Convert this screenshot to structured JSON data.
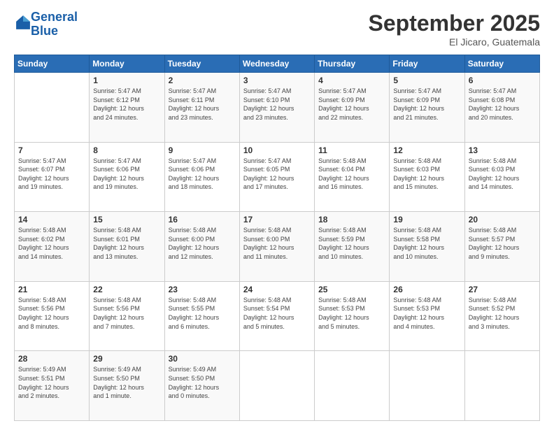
{
  "header": {
    "logo_line1": "General",
    "logo_line2": "Blue",
    "month": "September 2025",
    "location": "El Jicaro, Guatemala"
  },
  "columns": [
    "Sunday",
    "Monday",
    "Tuesday",
    "Wednesday",
    "Thursday",
    "Friday",
    "Saturday"
  ],
  "weeks": [
    [
      {
        "day": "",
        "text": ""
      },
      {
        "day": "1",
        "text": "Sunrise: 5:47 AM\nSunset: 6:12 PM\nDaylight: 12 hours\nand 24 minutes."
      },
      {
        "day": "2",
        "text": "Sunrise: 5:47 AM\nSunset: 6:11 PM\nDaylight: 12 hours\nand 23 minutes."
      },
      {
        "day": "3",
        "text": "Sunrise: 5:47 AM\nSunset: 6:10 PM\nDaylight: 12 hours\nand 23 minutes."
      },
      {
        "day": "4",
        "text": "Sunrise: 5:47 AM\nSunset: 6:09 PM\nDaylight: 12 hours\nand 22 minutes."
      },
      {
        "day": "5",
        "text": "Sunrise: 5:47 AM\nSunset: 6:09 PM\nDaylight: 12 hours\nand 21 minutes."
      },
      {
        "day": "6",
        "text": "Sunrise: 5:47 AM\nSunset: 6:08 PM\nDaylight: 12 hours\nand 20 minutes."
      }
    ],
    [
      {
        "day": "7",
        "text": "Sunrise: 5:47 AM\nSunset: 6:07 PM\nDaylight: 12 hours\nand 19 minutes."
      },
      {
        "day": "8",
        "text": "Sunrise: 5:47 AM\nSunset: 6:06 PM\nDaylight: 12 hours\nand 19 minutes."
      },
      {
        "day": "9",
        "text": "Sunrise: 5:47 AM\nSunset: 6:06 PM\nDaylight: 12 hours\nand 18 minutes."
      },
      {
        "day": "10",
        "text": "Sunrise: 5:47 AM\nSunset: 6:05 PM\nDaylight: 12 hours\nand 17 minutes."
      },
      {
        "day": "11",
        "text": "Sunrise: 5:48 AM\nSunset: 6:04 PM\nDaylight: 12 hours\nand 16 minutes."
      },
      {
        "day": "12",
        "text": "Sunrise: 5:48 AM\nSunset: 6:03 PM\nDaylight: 12 hours\nand 15 minutes."
      },
      {
        "day": "13",
        "text": "Sunrise: 5:48 AM\nSunset: 6:03 PM\nDaylight: 12 hours\nand 14 minutes."
      }
    ],
    [
      {
        "day": "14",
        "text": "Sunrise: 5:48 AM\nSunset: 6:02 PM\nDaylight: 12 hours\nand 14 minutes."
      },
      {
        "day": "15",
        "text": "Sunrise: 5:48 AM\nSunset: 6:01 PM\nDaylight: 12 hours\nand 13 minutes."
      },
      {
        "day": "16",
        "text": "Sunrise: 5:48 AM\nSunset: 6:00 PM\nDaylight: 12 hours\nand 12 minutes."
      },
      {
        "day": "17",
        "text": "Sunrise: 5:48 AM\nSunset: 6:00 PM\nDaylight: 12 hours\nand 11 minutes."
      },
      {
        "day": "18",
        "text": "Sunrise: 5:48 AM\nSunset: 5:59 PM\nDaylight: 12 hours\nand 10 minutes."
      },
      {
        "day": "19",
        "text": "Sunrise: 5:48 AM\nSunset: 5:58 PM\nDaylight: 12 hours\nand 10 minutes."
      },
      {
        "day": "20",
        "text": "Sunrise: 5:48 AM\nSunset: 5:57 PM\nDaylight: 12 hours\nand 9 minutes."
      }
    ],
    [
      {
        "day": "21",
        "text": "Sunrise: 5:48 AM\nSunset: 5:56 PM\nDaylight: 12 hours\nand 8 minutes."
      },
      {
        "day": "22",
        "text": "Sunrise: 5:48 AM\nSunset: 5:56 PM\nDaylight: 12 hours\nand 7 minutes."
      },
      {
        "day": "23",
        "text": "Sunrise: 5:48 AM\nSunset: 5:55 PM\nDaylight: 12 hours\nand 6 minutes."
      },
      {
        "day": "24",
        "text": "Sunrise: 5:48 AM\nSunset: 5:54 PM\nDaylight: 12 hours\nand 5 minutes."
      },
      {
        "day": "25",
        "text": "Sunrise: 5:48 AM\nSunset: 5:53 PM\nDaylight: 12 hours\nand 5 minutes."
      },
      {
        "day": "26",
        "text": "Sunrise: 5:48 AM\nSunset: 5:53 PM\nDaylight: 12 hours\nand 4 minutes."
      },
      {
        "day": "27",
        "text": "Sunrise: 5:48 AM\nSunset: 5:52 PM\nDaylight: 12 hours\nand 3 minutes."
      }
    ],
    [
      {
        "day": "28",
        "text": "Sunrise: 5:49 AM\nSunset: 5:51 PM\nDaylight: 12 hours\nand 2 minutes."
      },
      {
        "day": "29",
        "text": "Sunrise: 5:49 AM\nSunset: 5:50 PM\nDaylight: 12 hours\nand 1 minute."
      },
      {
        "day": "30",
        "text": "Sunrise: 5:49 AM\nSunset: 5:50 PM\nDaylight: 12 hours\nand 0 minutes."
      },
      {
        "day": "",
        "text": ""
      },
      {
        "day": "",
        "text": ""
      },
      {
        "day": "",
        "text": ""
      },
      {
        "day": "",
        "text": ""
      }
    ]
  ]
}
